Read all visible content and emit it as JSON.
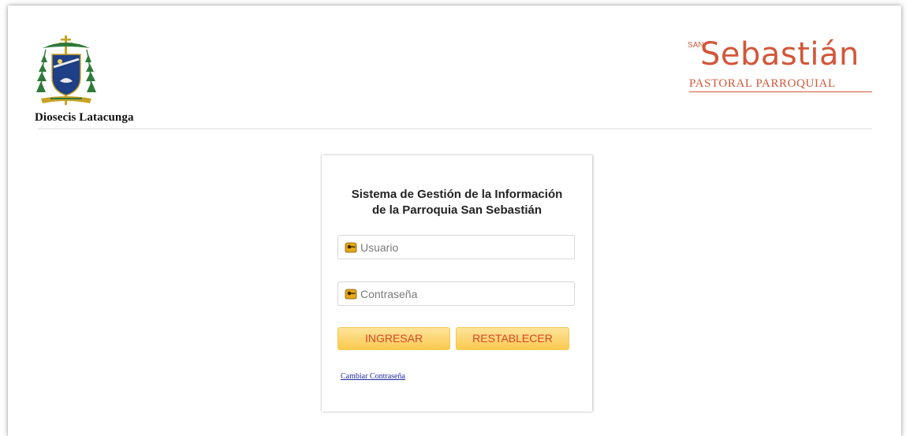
{
  "header": {
    "diocese_name": "Diosecis Latacunga",
    "brand_prefix": "SAN",
    "brand_name": "Sebastián",
    "brand_subtitle": "PASTORAL PARROQUIAL",
    "brand_color": "#d2573a"
  },
  "login": {
    "title_line1": "Sistema de Gestión de la Información",
    "title_line2": "de la Parroquia San Sebastián",
    "username_placeholder": "Usuario",
    "password_placeholder": "Contraseña",
    "login_button": "INGRESAR",
    "reset_button": "RESTABLECER",
    "change_password_link": "Cambiar Contraseña",
    "field_icon": "key-icon",
    "button_text_color": "#d6452b",
    "button_color": "#fcca4f"
  }
}
